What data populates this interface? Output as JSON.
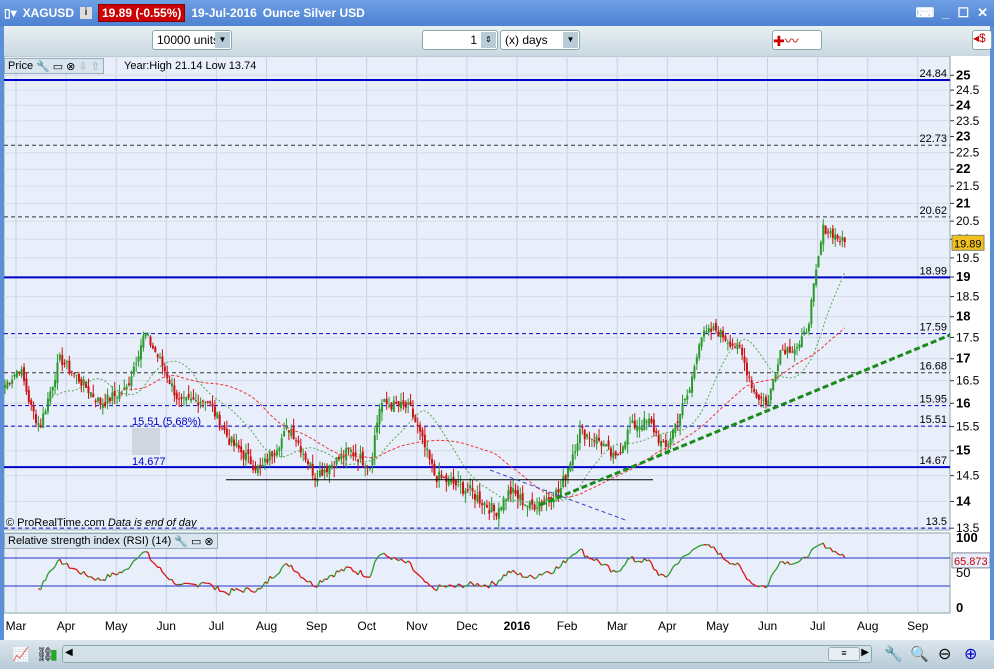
{
  "window": {
    "symbol": "XAGUSD",
    "price_badge": "19.89 (-0.55%)",
    "date": "19-Jul-2016",
    "description": "Ounce Silver USD"
  },
  "toolbar": {
    "units": "10000 units",
    "period_value": "1",
    "period_unit": "(x) days"
  },
  "price_panel": {
    "label": "Price",
    "year_info": "Year:High 21.14 Low 13.74",
    "copyright": "© ProRealTime.com",
    "note": "Data is end of day",
    "current_price": "19.89"
  },
  "rsi_panel": {
    "label": "Relative strength index (RSI) (14)",
    "current_value": "65.873",
    "ticks": [
      "100",
      "50",
      "0"
    ]
  },
  "chart_data": {
    "type": "candlestick",
    "scale": "log",
    "ylim": [
      13.4,
      25.2
    ],
    "x_labels": [
      "Mar",
      "Apr",
      "May",
      "Jun",
      "Jul",
      "Aug",
      "Sep",
      "Oct",
      "Nov",
      "Dec",
      "2016",
      "Feb",
      "Mar",
      "Apr",
      "May",
      "Jun",
      "Jul",
      "Aug",
      "Sep"
    ],
    "y_ticks": [
      "25",
      "24.5",
      "24",
      "23.5",
      "23",
      "22.5",
      "22",
      "21.5",
      "21",
      "20.5",
      "20",
      "19.5",
      "19",
      "18.5",
      "18",
      "17.5",
      "17",
      "16.5",
      "16",
      "15.5",
      "15",
      "14.5",
      "14",
      "13.5"
    ],
    "price_path_months_since_mar2015": [
      [
        -0.22,
        16.4
      ],
      [
        0.08,
        16.8
      ],
      [
        0.3,
        15.9
      ],
      [
        0.48,
        15.5
      ],
      [
        0.88,
        17.0
      ],
      [
        1.2,
        16.6
      ],
      [
        1.68,
        16.0
      ],
      [
        2.2,
        16.3
      ],
      [
        2.57,
        17.6
      ],
      [
        2.9,
        16.9
      ],
      [
        3.27,
        16.0
      ],
      [
        3.8,
        16.1
      ],
      [
        4.27,
        15.2
      ],
      [
        4.87,
        14.6
      ],
      [
        5.47,
        15.5
      ],
      [
        5.97,
        14.5
      ],
      [
        6.67,
        15.0
      ],
      [
        7.07,
        14.7
      ],
      [
        7.27,
        16.0
      ],
      [
        7.86,
        15.9
      ],
      [
        8.36,
        14.5
      ],
      [
        9.06,
        14.2
      ],
      [
        9.56,
        13.8
      ],
      [
        9.86,
        14.2
      ],
      [
        10.26,
        13.9
      ],
      [
        10.86,
        14.2
      ],
      [
        11.26,
        15.4
      ],
      [
        11.66,
        15.2
      ],
      [
        11.96,
        14.8
      ],
      [
        12.26,
        15.5
      ],
      [
        12.65,
        15.6
      ],
      [
        12.95,
        15.0
      ],
      [
        13.45,
        16.3
      ],
      [
        13.65,
        17.5
      ],
      [
        13.95,
        17.7
      ],
      [
        14.45,
        17.2
      ],
      [
        14.75,
        16.2
      ],
      [
        15.01,
        16.0
      ],
      [
        15.25,
        17.2
      ],
      [
        15.65,
        17.3
      ],
      [
        15.81,
        17.8
      ],
      [
        16.02,
        19.5
      ],
      [
        16.11,
        20.3
      ],
      [
        16.25,
        20.2
      ],
      [
        16.55,
        19.89
      ]
    ],
    "levels": [
      {
        "value": "24.84",
        "style": "solid-blue"
      },
      {
        "value": "22.73",
        "style": "dashed-black"
      },
      {
        "value": "20.62",
        "style": "dashed-black"
      },
      {
        "value": "18.99",
        "style": "solid-blue"
      },
      {
        "value": "17.59",
        "style": "dashed-blue"
      },
      {
        "value": "16.68",
        "style": "dashed-black"
      },
      {
        "value": "15.95",
        "style": "dashed-blue"
      },
      {
        "value": "15.51",
        "style": "dashed-blue"
      },
      {
        "value": "14.67",
        "style": "solid-blue"
      },
      {
        "value": "13.5",
        "style": "dashed-blue"
      }
    ],
    "annotations": [
      "15.51 (5.68%)",
      "14.677"
    ],
    "support_line": 14.42,
    "rsi_levels": [
      70,
      30
    ]
  },
  "colors": {
    "up": "#2a9a2a",
    "down": "#cc1111",
    "level_blue": "#0000cc",
    "badge": "#cc0000"
  }
}
